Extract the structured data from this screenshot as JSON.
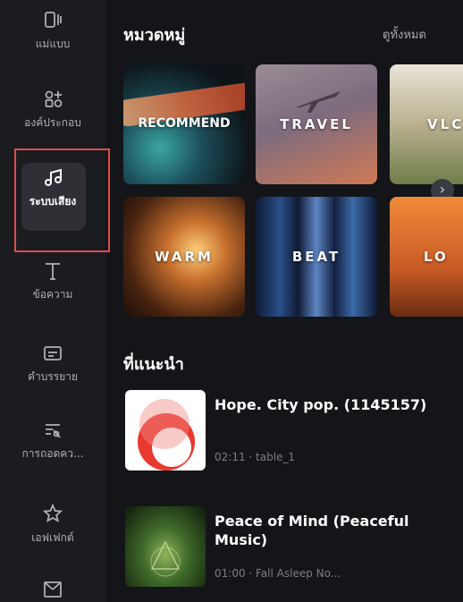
{
  "sidebar": {
    "items": [
      {
        "label": "แม่แบบ",
        "icon": "template-icon"
      },
      {
        "label": "องค์ประกอบ",
        "icon": "elements-icon"
      },
      {
        "label": "ระบบเสียง",
        "icon": "music-note-icon",
        "active": true
      },
      {
        "label": "ข้อความ",
        "icon": "text-icon"
      },
      {
        "label": "คำบรรยาย",
        "icon": "subtitle-icon"
      },
      {
        "label": "การถอดคว...",
        "icon": "transcript-icon"
      },
      {
        "label": "เอฟเฟกต์",
        "icon": "effects-icon"
      },
      {
        "label": "",
        "icon": "transition-icon"
      }
    ]
  },
  "categories": {
    "title": "หมวดหมู่",
    "view_all": "ดูทั้งหมด",
    "tiles": [
      {
        "label": "RECOMMEND"
      },
      {
        "label": "TRAVEL"
      },
      {
        "label": "VLC"
      },
      {
        "label": "WARM"
      },
      {
        "label": "BEAT"
      },
      {
        "label": "LO"
      }
    ]
  },
  "recommended": {
    "title": "ที่แนะนำ",
    "tracks": [
      {
        "name": "Hope. City pop. (1145157)",
        "meta": "02:11 · table_1"
      },
      {
        "name": "Peace of Mind (Peaceful Music)",
        "meta": "01:00 · Fall Asleep No..."
      }
    ]
  },
  "colors": {
    "background": "#141518",
    "sidebar": "#1b1c20",
    "highlight_border": "#e14c4c",
    "hope_thumb_red": "#e8392f"
  }
}
